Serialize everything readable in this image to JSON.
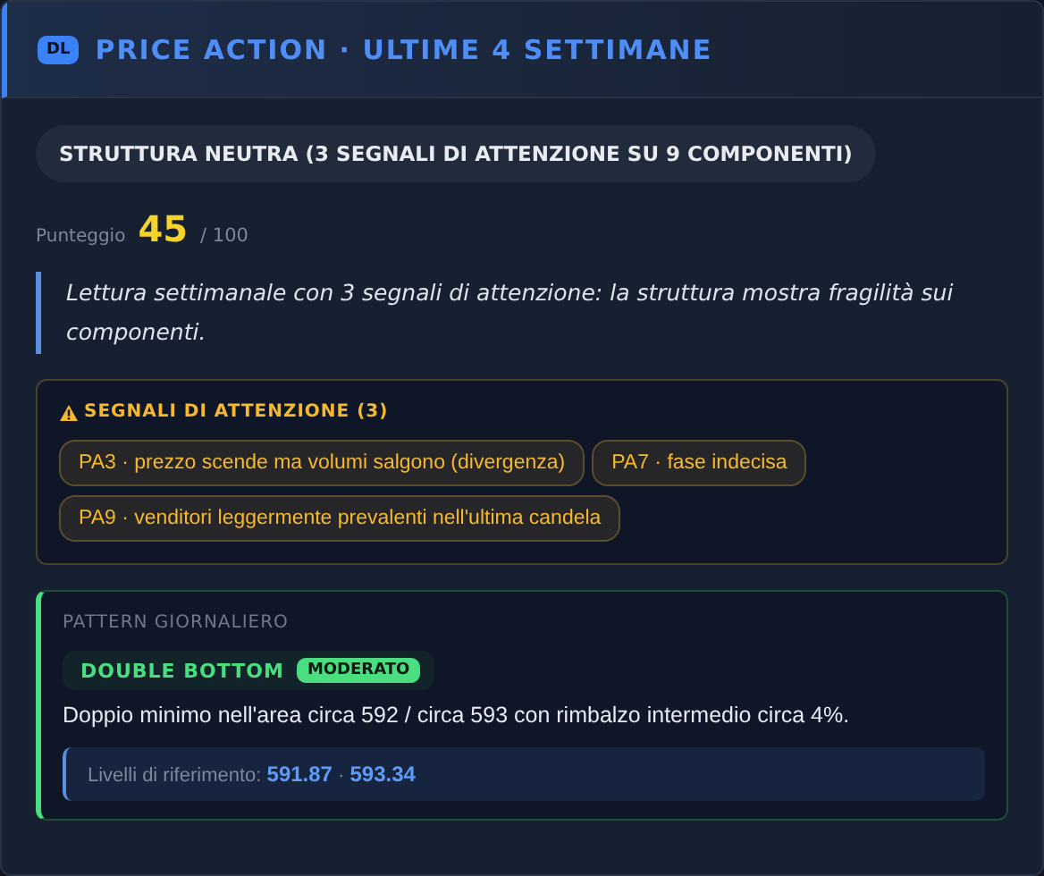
{
  "header": {
    "badge": "DL",
    "title": "PRICE ACTION · ULTIME 4 SETTIMANE"
  },
  "status": "STRUTTURA NEUTRA (3 SEGNALI DI ATTENZIONE SU 9 COMPONENTI)",
  "score": {
    "label": "Punteggio",
    "value": "45",
    "max": "/ 100"
  },
  "summary": "Lettura settimanale con 3 segnali di attenzione: la struttura mostra fragilità sui componenti.",
  "warnings": {
    "title": "SEGNALI DI ATTENZIONE (3)",
    "items": [
      {
        "text": "PA3 · prezzo scende ma volumi salgono (divergenza)"
      },
      {
        "text": "PA7 · fase indecisa"
      },
      {
        "text": "PA9 · venditori leggermente prevalenti nell'ultima candela"
      }
    ]
  },
  "pattern": {
    "heading": "PATTERN GIORNALIERO",
    "name": "DOUBLE BOTTOM",
    "strength": "MODERATO",
    "color": "#4ade80",
    "description": "Doppio minimo nell'area circa 592 / circa 593 con rimbalzo intermedio circa 4%.",
    "levels": "Livelli di riferimento: **591.87** · **593.34**"
  }
}
